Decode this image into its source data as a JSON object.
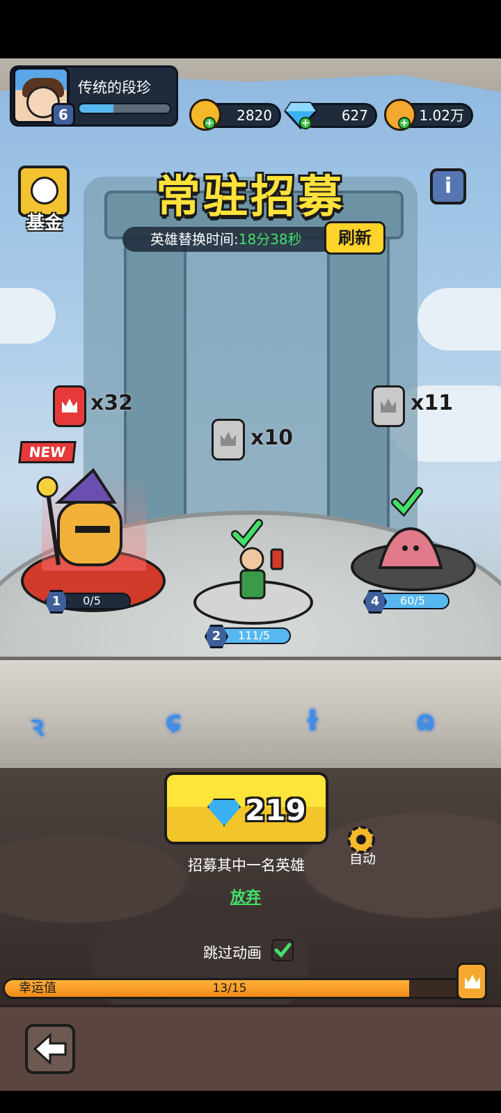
{
  "player": {
    "name": "传统的段珍",
    "level": "6",
    "xp_fraction": 0.38
  },
  "currencies": [
    {
      "name": "gold-coin",
      "value": "2820",
      "color": "#f5b82a"
    },
    {
      "name": "diamond",
      "value": "627",
      "color": "#3ab0f0"
    },
    {
      "name": "crown-coin",
      "value": "1.02万",
      "color": "#f5a830"
    }
  ],
  "header": {
    "title": "常驻招募",
    "fund_label": "基金",
    "info_icon": "info-icon"
  },
  "timer": {
    "label": "英雄替换时间:",
    "value": "18分38秒",
    "refresh_label": "刷新"
  },
  "heroes": [
    {
      "slot": "1",
      "progress": "0/5",
      "fill": 0.0,
      "token_color": "red",
      "token_count": "x32",
      "is_new": true,
      "new_label": "NEW",
      "name": "wizard-dog-hero",
      "checked": false
    },
    {
      "slot": "2",
      "progress": "111/5",
      "fill": 1.0,
      "token_color": "grey",
      "token_count": "x10",
      "name": "soldier-hero",
      "checked": true
    },
    {
      "slot": "4",
      "progress": "60/5",
      "fill": 1.0,
      "token_color": "grey",
      "token_count": "x11",
      "name": "slime-hero",
      "checked": true
    }
  ],
  "recruit": {
    "cost": "219",
    "description": "招募其中一名英雄",
    "abandon_label": "放弃",
    "auto_label": "自动",
    "skip_label": "跳过动画",
    "skip_checked": true
  },
  "luck": {
    "label": "幸运值",
    "value": "13/15",
    "fraction": 0.8667
  },
  "colors": {
    "title": "#ffe23a",
    "timer_value": "#45e06a",
    "abandon": "#45e06a",
    "progress_fill": "#57b8f0"
  }
}
